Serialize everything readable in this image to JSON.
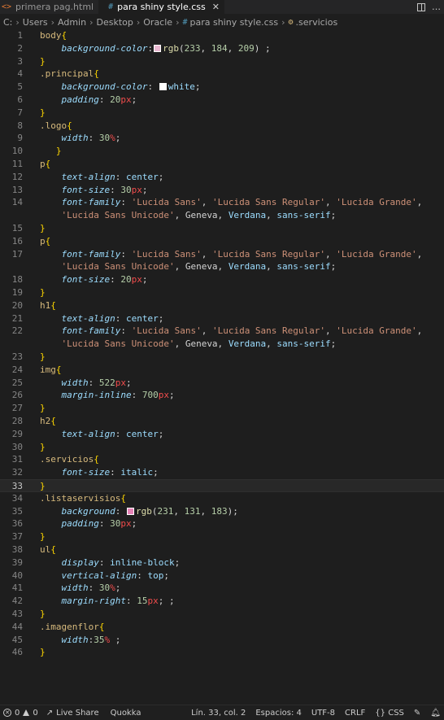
{
  "tabs": [
    {
      "label": "primera pag.html",
      "icon": "html-file-icon",
      "active": false
    },
    {
      "label": "para shiny style.css",
      "icon": "css-file-icon",
      "active": true
    }
  ],
  "breadcrumb": {
    "drive": "C:",
    "folders": [
      "Users",
      "Admin",
      "Desktop",
      "Oracle"
    ],
    "file": "para shiny style.css",
    "symbol": ".servicios"
  },
  "editor": {
    "current_line": 33,
    "lines": [
      {
        "n": "1",
        "tokens": [
          [
            "sel",
            "body"
          ],
          [
            "brace",
            "{"
          ]
        ]
      },
      {
        "n": "2",
        "tokens": [
          [
            "ind",
            "    "
          ],
          [
            "prop",
            "background-color"
          ],
          [
            "punc",
            ":"
          ],
          [
            "swatch",
            "#e9b8d1"
          ],
          [
            "fn",
            "rgb"
          ],
          [
            "punc",
            "("
          ],
          [
            "num",
            "233"
          ],
          [
            "punc",
            ", "
          ],
          [
            "num",
            "184"
          ],
          [
            "punc",
            ", "
          ],
          [
            "num",
            "209"
          ],
          [
            "punc",
            ") ;"
          ]
        ]
      },
      {
        "n": "3",
        "tokens": [
          [
            "brace",
            "}"
          ]
        ]
      },
      {
        "n": "4",
        "tokens": [
          [
            "sel",
            ".principal"
          ],
          [
            "brace",
            "{"
          ]
        ]
      },
      {
        "n": "5",
        "tokens": [
          [
            "ind",
            "    "
          ],
          [
            "prop",
            "background-color"
          ],
          [
            "punc",
            ": "
          ],
          [
            "swatch",
            "#ffffff"
          ],
          [
            "kw",
            "white"
          ],
          [
            "punc",
            ";"
          ]
        ]
      },
      {
        "n": "6",
        "tokens": [
          [
            "ind",
            "    "
          ],
          [
            "prop",
            "padding"
          ],
          [
            "punc",
            ": "
          ],
          [
            "num",
            "20"
          ],
          [
            "unit",
            "px"
          ],
          [
            "punc",
            ";"
          ]
        ]
      },
      {
        "n": "7",
        "tokens": [
          [
            "brace",
            "}"
          ]
        ]
      },
      {
        "n": "8",
        "tokens": [
          [
            "sel",
            ".logo"
          ],
          [
            "brace",
            "{"
          ]
        ]
      },
      {
        "n": "9",
        "tokens": [
          [
            "ind",
            "    "
          ],
          [
            "prop",
            "width"
          ],
          [
            "punc",
            ": "
          ],
          [
            "num",
            "30"
          ],
          [
            "unit",
            "%"
          ],
          [
            "punc",
            ";"
          ]
        ]
      },
      {
        "n": "10",
        "tokens": [
          [
            "ind",
            "   "
          ],
          [
            "brace",
            "}"
          ]
        ]
      },
      {
        "n": "11",
        "tokens": [
          [
            "sel",
            "p"
          ],
          [
            "brace",
            "{"
          ]
        ]
      },
      {
        "n": "12",
        "tokens": [
          [
            "ind",
            "    "
          ],
          [
            "prop",
            "text-align"
          ],
          [
            "punc",
            ": "
          ],
          [
            "kw",
            "center"
          ],
          [
            "punc",
            ";"
          ]
        ]
      },
      {
        "n": "13",
        "tokens": [
          [
            "ind",
            "    "
          ],
          [
            "prop",
            "font-size"
          ],
          [
            "punc",
            ": "
          ],
          [
            "num",
            "30"
          ],
          [
            "unit",
            "px"
          ],
          [
            "punc",
            ";"
          ]
        ]
      },
      {
        "n": "14",
        "tokens": [
          [
            "ind",
            "    "
          ],
          [
            "prop",
            "font-family"
          ],
          [
            "punc",
            ": "
          ],
          [
            "str",
            "'Lucida Sans'"
          ],
          [
            "punc",
            ", "
          ],
          [
            "str",
            "'Lucida Sans Regular'"
          ],
          [
            "punc",
            ", "
          ],
          [
            "str",
            "'Lucida Grande'"
          ],
          [
            "punc",
            ","
          ]
        ]
      },
      {
        "n": "",
        "tokens": [
          [
            "ind",
            "    "
          ],
          [
            "str",
            "'Lucida Sans Unicode'"
          ],
          [
            "punc",
            ", Geneva, "
          ],
          [
            "kw",
            "Verdana"
          ],
          [
            "punc",
            ", "
          ],
          [
            "kw",
            "sans-serif"
          ],
          [
            "punc",
            ";"
          ]
        ]
      },
      {
        "n": "15",
        "tokens": [
          [
            "brace",
            "}"
          ]
        ]
      },
      {
        "n": "16",
        "tokens": [
          [
            "sel",
            "p"
          ],
          [
            "brace",
            "{"
          ]
        ]
      },
      {
        "n": "17",
        "tokens": [
          [
            "ind",
            "    "
          ],
          [
            "prop",
            "font-family"
          ],
          [
            "punc",
            ": "
          ],
          [
            "str",
            "'Lucida Sans'"
          ],
          [
            "punc",
            ", "
          ],
          [
            "str",
            "'Lucida Sans Regular'"
          ],
          [
            "punc",
            ", "
          ],
          [
            "str",
            "'Lucida Grande'"
          ],
          [
            "punc",
            ","
          ]
        ]
      },
      {
        "n": "",
        "tokens": [
          [
            "ind",
            "    "
          ],
          [
            "str",
            "'Lucida Sans Unicode'"
          ],
          [
            "punc",
            ", Geneva, "
          ],
          [
            "kw",
            "Verdana"
          ],
          [
            "punc",
            ", "
          ],
          [
            "kw",
            "sans-serif"
          ],
          [
            "punc",
            ";"
          ]
        ]
      },
      {
        "n": "18",
        "tokens": [
          [
            "ind",
            "    "
          ],
          [
            "prop",
            "font-size"
          ],
          [
            "punc",
            ": "
          ],
          [
            "num",
            "20"
          ],
          [
            "unit",
            "px"
          ],
          [
            "punc",
            ";"
          ]
        ]
      },
      {
        "n": "19",
        "tokens": [
          [
            "brace",
            "}"
          ]
        ]
      },
      {
        "n": "20",
        "tokens": [
          [
            "sel",
            "h1"
          ],
          [
            "brace",
            "{"
          ]
        ]
      },
      {
        "n": "21",
        "tokens": [
          [
            "ind",
            "    "
          ],
          [
            "prop",
            "text-align"
          ],
          [
            "punc",
            ": "
          ],
          [
            "kw",
            "center"
          ],
          [
            "punc",
            ";"
          ]
        ]
      },
      {
        "n": "22",
        "tokens": [
          [
            "ind",
            "    "
          ],
          [
            "prop",
            "font-family"
          ],
          [
            "punc",
            ": "
          ],
          [
            "str",
            "'Lucida Sans'"
          ],
          [
            "punc",
            ", "
          ],
          [
            "str",
            "'Lucida Sans Regular'"
          ],
          [
            "punc",
            ", "
          ],
          [
            "str",
            "'Lucida Grande'"
          ],
          [
            "punc",
            ","
          ]
        ]
      },
      {
        "n": "",
        "tokens": [
          [
            "ind",
            "    "
          ],
          [
            "str",
            "'Lucida Sans Unicode'"
          ],
          [
            "punc",
            ", Geneva, "
          ],
          [
            "kw",
            "Verdana"
          ],
          [
            "punc",
            ", "
          ],
          [
            "kw",
            "sans-serif"
          ],
          [
            "punc",
            ";"
          ]
        ]
      },
      {
        "n": "23",
        "tokens": [
          [
            "brace",
            "}"
          ]
        ]
      },
      {
        "n": "24",
        "tokens": [
          [
            "sel",
            "img"
          ],
          [
            "brace",
            "{"
          ]
        ]
      },
      {
        "n": "25",
        "tokens": [
          [
            "ind",
            "    "
          ],
          [
            "prop",
            "width"
          ],
          [
            "punc",
            ": "
          ],
          [
            "num",
            "522"
          ],
          [
            "unit",
            "px"
          ],
          [
            "punc",
            ";"
          ]
        ]
      },
      {
        "n": "26",
        "tokens": [
          [
            "ind",
            "    "
          ],
          [
            "prop",
            "margin-inline"
          ],
          [
            "punc",
            ": "
          ],
          [
            "num",
            "700"
          ],
          [
            "unit",
            "px"
          ],
          [
            "punc",
            ";"
          ]
        ]
      },
      {
        "n": "27",
        "tokens": [
          [
            "brace",
            "}"
          ]
        ]
      },
      {
        "n": "28",
        "tokens": [
          [
            "sel",
            "h2"
          ],
          [
            "brace",
            "{"
          ]
        ]
      },
      {
        "n": "29",
        "tokens": [
          [
            "ind",
            "    "
          ],
          [
            "prop",
            "text-align"
          ],
          [
            "punc",
            ": "
          ],
          [
            "kw",
            "center"
          ],
          [
            "punc",
            ";"
          ]
        ]
      },
      {
        "n": "30",
        "tokens": [
          [
            "brace",
            "}"
          ]
        ]
      },
      {
        "n": "31",
        "tokens": [
          [
            "sel",
            ".servicios"
          ],
          [
            "brace",
            "{"
          ]
        ]
      },
      {
        "n": "32",
        "tokens": [
          [
            "ind",
            "    "
          ],
          [
            "prop",
            "font-size"
          ],
          [
            "punc",
            ": "
          ],
          [
            "kw",
            "italic"
          ],
          [
            "punc",
            ";"
          ]
        ]
      },
      {
        "n": "33",
        "tokens": [
          [
            "brace",
            "}"
          ]
        ]
      },
      {
        "n": "34",
        "tokens": [
          [
            "sel",
            ".listaservisios"
          ],
          [
            "brace",
            "{"
          ]
        ]
      },
      {
        "n": "35",
        "tokens": [
          [
            "ind",
            "    "
          ],
          [
            "prop",
            "background"
          ],
          [
            "punc",
            ": "
          ],
          [
            "swatch",
            "#e783b7"
          ],
          [
            "fn",
            "rgb"
          ],
          [
            "punc",
            "("
          ],
          [
            "num",
            "231"
          ],
          [
            "punc",
            ", "
          ],
          [
            "num",
            "131"
          ],
          [
            "punc",
            ", "
          ],
          [
            "num",
            "183"
          ],
          [
            "punc",
            ");"
          ]
        ]
      },
      {
        "n": "36",
        "tokens": [
          [
            "ind",
            "    "
          ],
          [
            "prop",
            "padding"
          ],
          [
            "punc",
            ": "
          ],
          [
            "num",
            "30"
          ],
          [
            "unit",
            "px"
          ],
          [
            "punc",
            ";"
          ]
        ]
      },
      {
        "n": "37",
        "tokens": [
          [
            "brace",
            "}"
          ]
        ]
      },
      {
        "n": "38",
        "tokens": [
          [
            "sel",
            "ul"
          ],
          [
            "brace",
            "{"
          ]
        ]
      },
      {
        "n": "39",
        "tokens": [
          [
            "ind",
            "    "
          ],
          [
            "prop",
            "display"
          ],
          [
            "punc",
            ": "
          ],
          [
            "kw",
            "inline-block"
          ],
          [
            "punc",
            ";"
          ]
        ]
      },
      {
        "n": "40",
        "tokens": [
          [
            "ind",
            "    "
          ],
          [
            "prop",
            "vertical-align"
          ],
          [
            "punc",
            ": "
          ],
          [
            "kw",
            "top"
          ],
          [
            "punc",
            ";"
          ]
        ]
      },
      {
        "n": "41",
        "tokens": [
          [
            "ind",
            "    "
          ],
          [
            "prop",
            "width"
          ],
          [
            "punc",
            ": "
          ],
          [
            "num",
            "30"
          ],
          [
            "unit",
            "%"
          ],
          [
            "punc",
            ";"
          ]
        ]
      },
      {
        "n": "42",
        "tokens": [
          [
            "ind",
            "    "
          ],
          [
            "prop",
            "margin-right"
          ],
          [
            "punc",
            ": "
          ],
          [
            "num",
            "15"
          ],
          [
            "unit",
            "px"
          ],
          [
            "punc",
            "; ;"
          ]
        ]
      },
      {
        "n": "43",
        "tokens": [
          [
            "brace",
            "}"
          ]
        ]
      },
      {
        "n": "44",
        "tokens": [
          [
            "sel",
            ".imagenflor"
          ],
          [
            "brace",
            "{"
          ]
        ]
      },
      {
        "n": "45",
        "tokens": [
          [
            "ind",
            "    "
          ],
          [
            "prop",
            "width"
          ],
          [
            "punc",
            ":"
          ],
          [
            "num",
            "35"
          ],
          [
            "unit",
            "%"
          ],
          [
            "punc",
            " ;"
          ]
        ]
      },
      {
        "n": "46",
        "tokens": [
          [
            "brace",
            "}"
          ]
        ]
      }
    ]
  },
  "statusbar": {
    "errors": "0",
    "warnings": "0",
    "live_share": "Live Share",
    "quokka": "Quokka",
    "cursor": "Lín. 33, col. 2",
    "spaces": "Espacios: 4",
    "encoding": "UTF-8",
    "eol": "CRLF",
    "language": "CSS"
  }
}
